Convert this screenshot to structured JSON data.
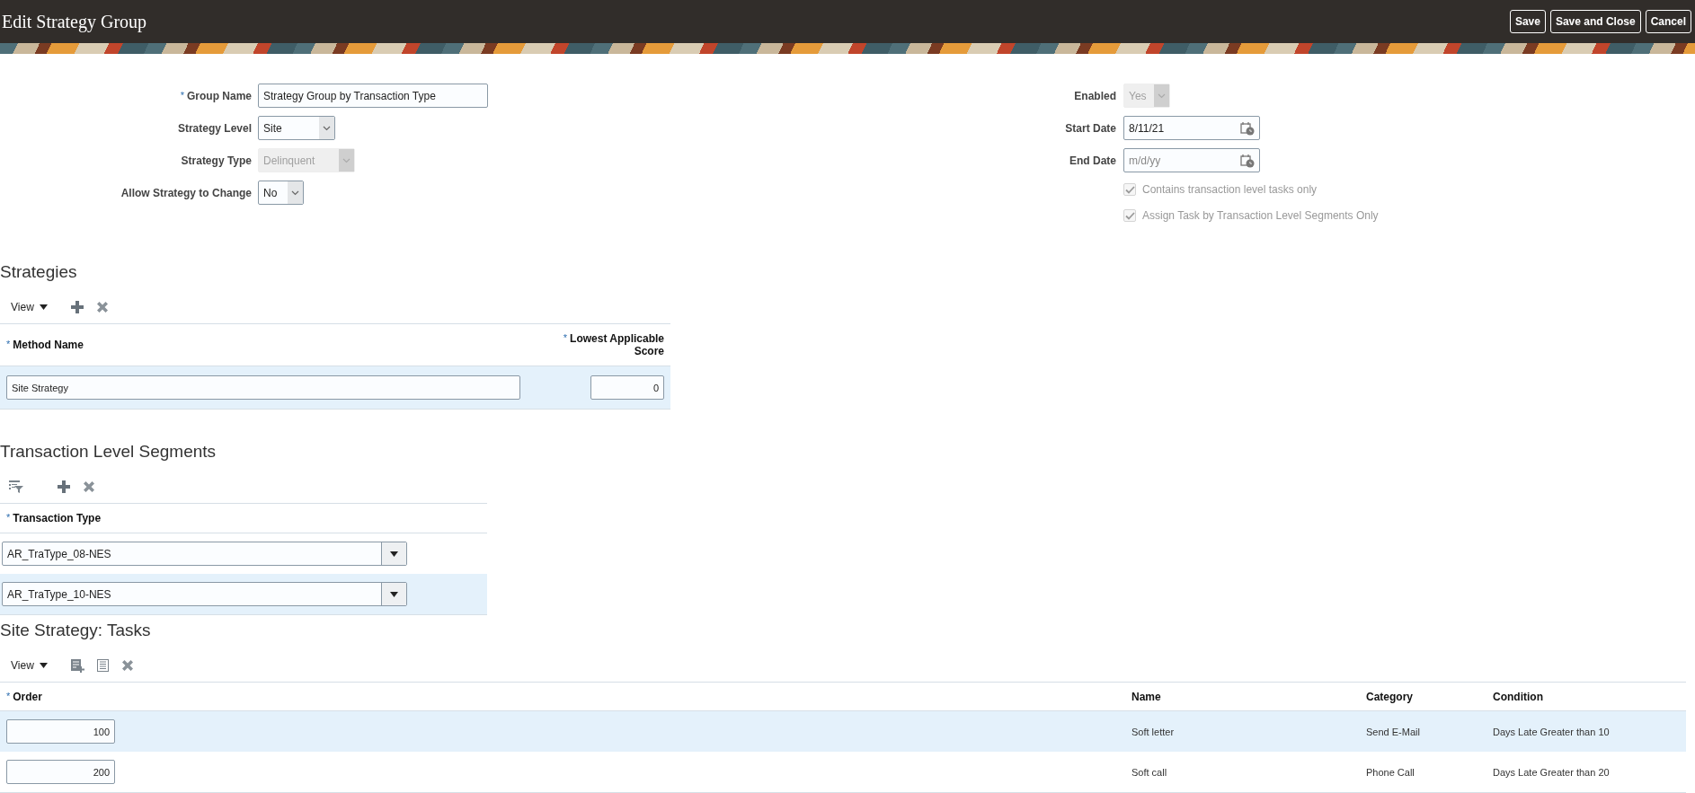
{
  "header": {
    "title": "Edit Strategy Group",
    "buttons": [
      {
        "label": "Save"
      },
      {
        "label": "Save and Close"
      },
      {
        "label": "Cancel"
      }
    ]
  },
  "form": {
    "left": [
      {
        "label": "Group Name",
        "required_mark": "*",
        "kind": "text",
        "value": "Strategy Group by Transaction Type"
      },
      {
        "label": "Strategy Level",
        "kind": "select",
        "value": "Site",
        "disabled": false
      },
      {
        "label": "Strategy Type",
        "kind": "select",
        "value": "Delinquent",
        "disabled": true
      },
      {
        "label": "Allow Strategy to Change",
        "kind": "select",
        "value": "No",
        "disabled": false
      }
    ],
    "right": [
      {
        "label": "Enabled",
        "kind": "select",
        "value": "Yes",
        "disabled": true
      },
      {
        "label": "Start Date",
        "kind": "date",
        "value": "8/11/21"
      },
      {
        "label": "End Date",
        "kind": "date",
        "placeholder": "m/d/yy"
      },
      {
        "label": "Contains transaction level tasks only",
        "kind": "checkbox",
        "checked": true,
        "disabled": true
      },
      {
        "label": "Assign Task by Transaction Level Segments Only",
        "kind": "checkbox",
        "checked": true,
        "disabled": true
      }
    ]
  },
  "strategies": {
    "title": "Strategies",
    "view_menu": "View",
    "columns": [
      {
        "label": "Method Name",
        "required_mark": "*"
      },
      {
        "label": "Lowest Applicable Score",
        "required_mark": "*"
      }
    ],
    "rows": [
      {
        "selected": true,
        "method_name": "Site Strategy",
        "score": "0"
      }
    ]
  },
  "segments": {
    "title": "Transaction Level Segments",
    "columns": [
      {
        "label": "Transaction Type",
        "required_mark": "*"
      }
    ],
    "rows": [
      {
        "selected": false,
        "transaction_type": "AR_TraType_08-NES"
      },
      {
        "selected": true,
        "transaction_type": "AR_TraType_10-NES"
      }
    ]
  },
  "tasks": {
    "title": "Site Strategy: Tasks",
    "view_menu": "View",
    "columns": [
      {
        "label": "Order",
        "required_mark": "*"
      },
      {
        "label": "Name"
      },
      {
        "label": "Category"
      },
      {
        "label": "Condition"
      }
    ],
    "rows": [
      {
        "selected": true,
        "order": "100",
        "name": "Soft letter",
        "category": "Send E-Mail",
        "condition": "Days Late Greater than 10"
      },
      {
        "selected": false,
        "order": "200",
        "name": "Soft call",
        "category": "Phone Call",
        "condition": "Days Late Greater than 20"
      }
    ]
  }
}
